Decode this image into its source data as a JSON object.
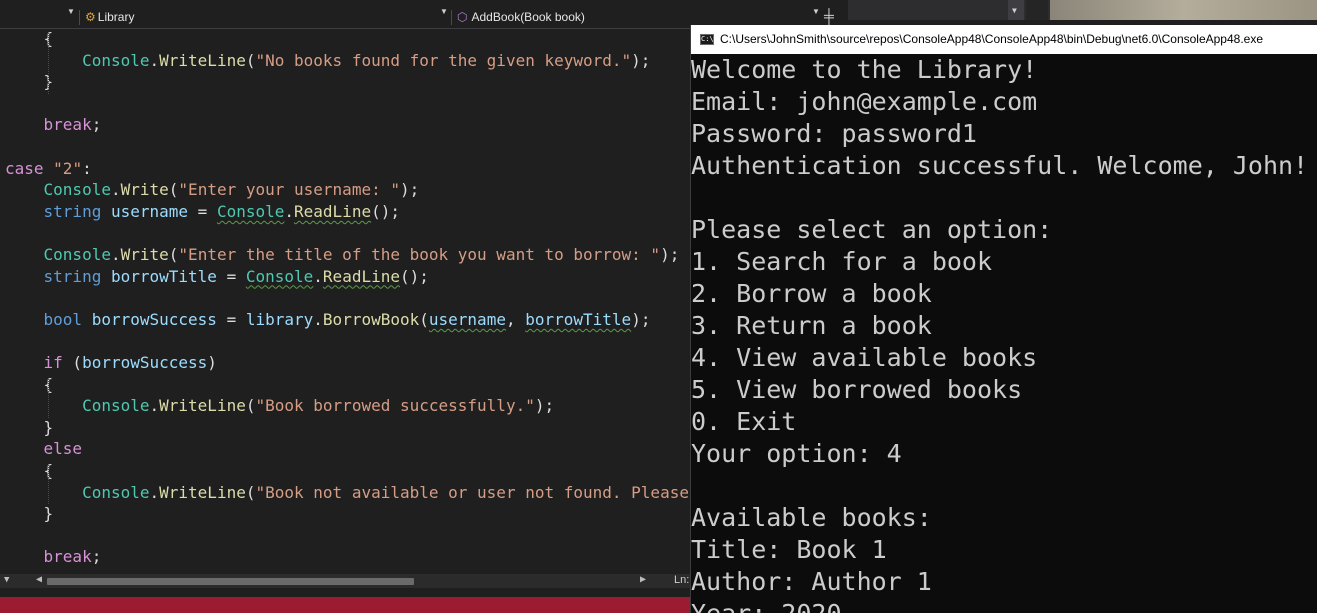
{
  "navbar": {
    "project": "Library",
    "member": "AddBook(Book book)"
  },
  "console": {
    "title": "C:\\Users\\JohnSmith\\source\\repos\\ConsoleApp48\\ConsoleApp48\\bin\\Debug\\net6.0\\ConsoleApp48.exe",
    "lines": [
      "Welcome to the Library!",
      "Email: john@example.com",
      "Password: password1",
      "Authentication successful. Welcome, John!",
      "",
      "Please select an option:",
      "1. Search for a book",
      "2. Borrow a book",
      "3. Return a book",
      "4. View available books",
      "5. View borrowed books",
      "0. Exit",
      "Your option: 4",
      "",
      "Available books:",
      "Title: Book 1",
      "Author: Author 1",
      "Year: 2020"
    ]
  },
  "code": [
    [
      [
        "pl",
        "    {"
      ]
    ],
    [
      [
        "pl",
        "        "
      ],
      [
        "ty",
        "Console"
      ],
      [
        "pl",
        "."
      ],
      [
        "fn",
        "WriteLine"
      ],
      [
        "pl",
        "("
      ],
      [
        "str",
        "\"No books found for the given keyword.\""
      ],
      [
        "pl",
        ");"
      ]
    ],
    [
      [
        "pl",
        "    }"
      ]
    ],
    [
      [
        "pl",
        ""
      ]
    ],
    [
      [
        "pl",
        "    "
      ],
      [
        "kw",
        "break"
      ],
      [
        "pl",
        ";"
      ]
    ],
    [
      [
        "pl",
        ""
      ]
    ],
    [
      [
        "kw",
        "case"
      ],
      [
        "pl",
        " "
      ],
      [
        "str",
        "\"2\""
      ],
      [
        "pl",
        ":"
      ]
    ],
    [
      [
        "pl",
        "    "
      ],
      [
        "ty",
        "Console"
      ],
      [
        "pl",
        "."
      ],
      [
        "fn",
        "Write"
      ],
      [
        "pl",
        "("
      ],
      [
        "str",
        "\"Enter your username: \""
      ],
      [
        "pl",
        ");"
      ]
    ],
    [
      [
        "pl",
        "    "
      ],
      [
        "kwb",
        "string"
      ],
      [
        "pl",
        " "
      ],
      [
        "var",
        "username"
      ],
      [
        "pl",
        " = "
      ],
      [
        "ty",
        "Console",
        1
      ],
      [
        "pl",
        "."
      ],
      [
        "fn",
        "ReadLine",
        1
      ],
      [
        "pl",
        "();"
      ]
    ],
    [
      [
        "pl",
        ""
      ]
    ],
    [
      [
        "pl",
        "    "
      ],
      [
        "ty",
        "Console"
      ],
      [
        "pl",
        "."
      ],
      [
        "fn",
        "Write"
      ],
      [
        "pl",
        "("
      ],
      [
        "str",
        "\"Enter the title of the book you want to borrow: \""
      ],
      [
        "pl",
        ");"
      ]
    ],
    [
      [
        "pl",
        "    "
      ],
      [
        "kwb",
        "string"
      ],
      [
        "pl",
        " "
      ],
      [
        "var",
        "borrowTitle"
      ],
      [
        "pl",
        " = "
      ],
      [
        "ty",
        "Console",
        1
      ],
      [
        "pl",
        "."
      ],
      [
        "fn",
        "ReadLine",
        1
      ],
      [
        "pl",
        "();"
      ]
    ],
    [
      [
        "pl",
        ""
      ]
    ],
    [
      [
        "pl",
        "    "
      ],
      [
        "kwb",
        "bool"
      ],
      [
        "pl",
        " "
      ],
      [
        "var",
        "borrowSuccess"
      ],
      [
        "pl",
        " = "
      ],
      [
        "var",
        "library"
      ],
      [
        "pl",
        "."
      ],
      [
        "fn",
        "BorrowBook"
      ],
      [
        "pl",
        "("
      ],
      [
        "var",
        "username",
        1
      ],
      [
        "pl",
        ", "
      ],
      [
        "var",
        "borrowTitle",
        1
      ],
      [
        "pl",
        ");"
      ]
    ],
    [
      [
        "pl",
        ""
      ]
    ],
    [
      [
        "pl",
        "    "
      ],
      [
        "kw",
        "if"
      ],
      [
        "pl",
        " ("
      ],
      [
        "var",
        "borrowSuccess"
      ],
      [
        "pl",
        ")"
      ]
    ],
    [
      [
        "pl",
        "    {"
      ]
    ],
    [
      [
        "pl",
        "        "
      ],
      [
        "ty",
        "Console"
      ],
      [
        "pl",
        "."
      ],
      [
        "fn",
        "WriteLine"
      ],
      [
        "pl",
        "("
      ],
      [
        "str",
        "\"Book borrowed successfully.\""
      ],
      [
        "pl",
        ");"
      ]
    ],
    [
      [
        "pl",
        "    }"
      ]
    ],
    [
      [
        "pl",
        "    "
      ],
      [
        "kw",
        "else"
      ]
    ],
    [
      [
        "pl",
        "    {"
      ]
    ],
    [
      [
        "pl",
        "        "
      ],
      [
        "ty",
        "Console"
      ],
      [
        "pl",
        "."
      ],
      [
        "fn",
        "WriteLine"
      ],
      [
        "pl",
        "("
      ],
      [
        "str",
        "\"Book not available or user not found. Please"
      ]
    ],
    [
      [
        "pl",
        "    }"
      ]
    ],
    [
      [
        "pl",
        ""
      ]
    ],
    [
      [
        "pl",
        "    "
      ],
      [
        "kw",
        "break"
      ],
      [
        "pl",
        ";"
      ]
    ]
  ]
}
